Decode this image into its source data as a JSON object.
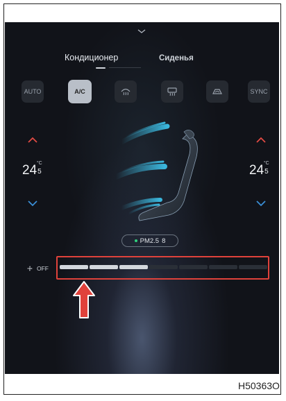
{
  "tabs": [
    {
      "label": "Кондиционер",
      "active": true
    },
    {
      "label": "Сиденья",
      "active": false
    }
  ],
  "quick_buttons": [
    {
      "label": "AUTO",
      "active": false
    },
    {
      "label": "A/C",
      "active": true
    },
    {
      "label": "",
      "icon": "front-defrost-icon",
      "active": false
    },
    {
      "label": "",
      "icon": "rear-defrost-icon",
      "active": false
    },
    {
      "label": "",
      "icon": "recirculation-icon",
      "active": false
    },
    {
      "label": "SYNC",
      "active": false
    }
  ],
  "climate": {
    "driver_temp_int": "24",
    "driver_temp_dec": "5",
    "passenger_temp_int": "24",
    "passenger_temp_dec": "5",
    "unit": "°C"
  },
  "air_quality": {
    "label": "PM2.5",
    "value": "8"
  },
  "fan": {
    "off_label": "OFF",
    "segments_total": 7,
    "segments_on": 3
  },
  "figure_code": "H50363O",
  "colors": {
    "highlight": "#e0423b",
    "temp_up_arrow": "#e24a44",
    "temp_down_arrow": "#3b8fd6",
    "pm_dot": "#2fd07d",
    "airflow": "#3ec7f0"
  }
}
